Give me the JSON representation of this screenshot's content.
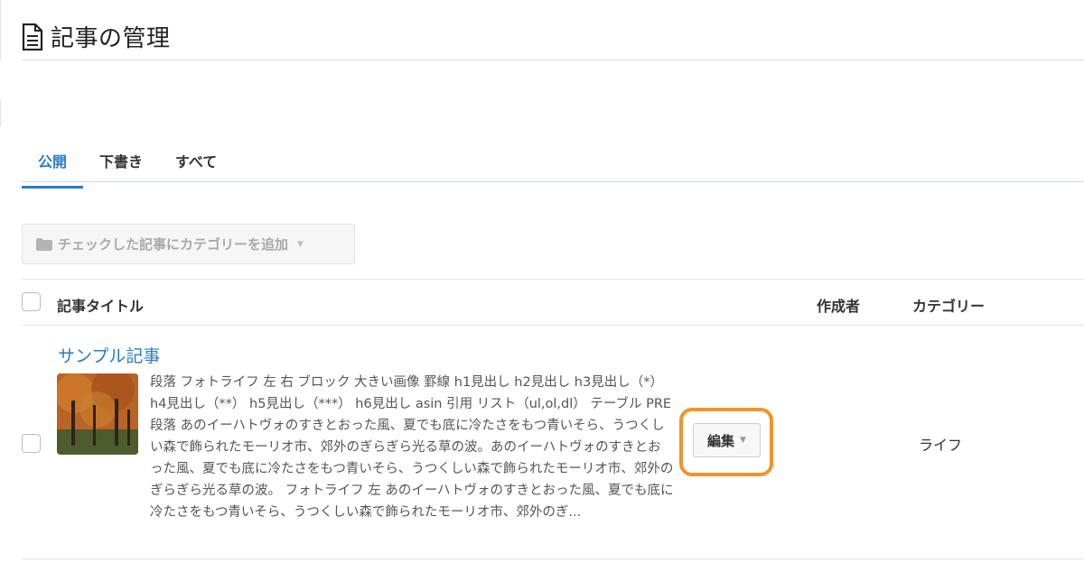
{
  "header": {
    "title": "記事の管理",
    "icon": "document-icon"
  },
  "tabs": [
    {
      "label": "公開",
      "active": true
    },
    {
      "label": "下書き",
      "active": false
    },
    {
      "label": "すべて",
      "active": false
    }
  ],
  "bulk_action": {
    "label": "チェックした記事にカテゴリーを追加",
    "icon": "folder-icon"
  },
  "table": {
    "columns": {
      "title": "記事タイトル",
      "author": "作成者",
      "category": "カテゴリー"
    },
    "rows": [
      {
        "title": "サンプル記事",
        "excerpt": "段落 フォトライフ 左 右 ブロック 大きい画像 罫線 h1見出し h2見出し h3見出し（*） h4見出し（**） h5見出し（***） h6見出し asin 引用 リスト（ul,ol,dl） テーブル PRE 段落 あのイーハトヴォのすきとおった風、夏でも底に冷たさをもつ青いそら、うつくしい森で飾られたモーリオ市、郊外のぎらぎら光る草の波。あのイーハトヴォのすきとおった風、夏でも底に冷たさをもつ青いそら、うつくしい森で飾られたモーリオ市、郊外のぎらぎら光る草の波。 フォトライフ 左 あのイーハトヴォのすきとおった風、夏でも底に冷たさをもつ青いそら、うつくしい森で飾られたモーリオ市、郊外のぎ...",
        "edit_label": "編集",
        "category": "ライフ"
      }
    ]
  },
  "colors": {
    "accent": "#2b7bc4",
    "highlight": "#f0952a"
  }
}
